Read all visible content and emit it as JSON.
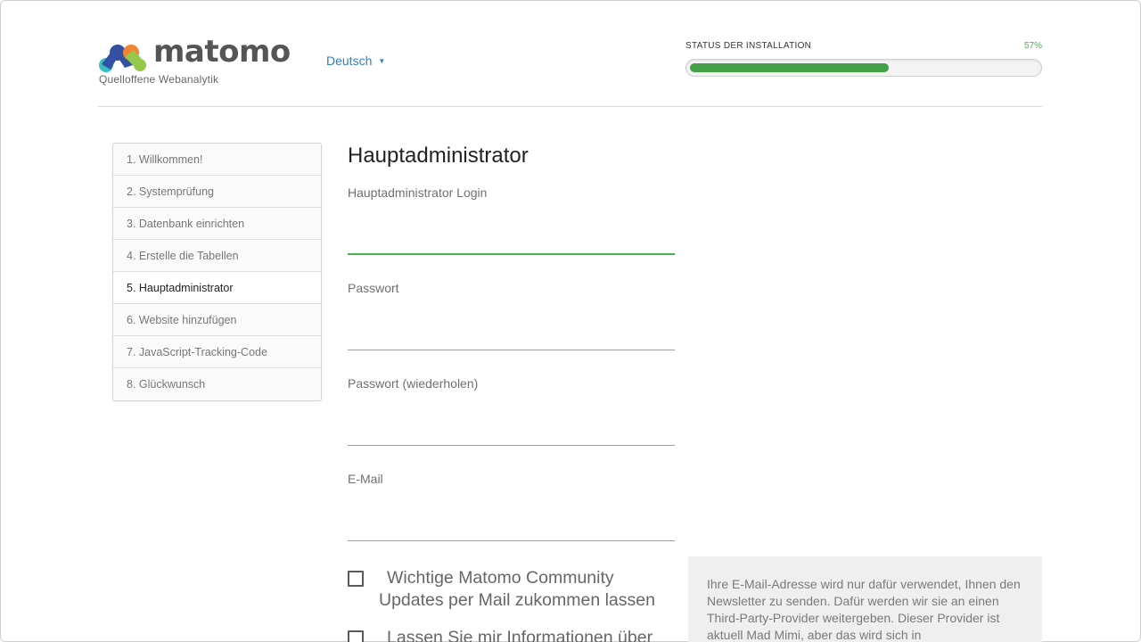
{
  "header": {
    "logo_text": "matomo",
    "tagline": "Quelloffene Webanalytik",
    "language": "Deutsch",
    "progress_label": "STATUS DER INSTALLATION",
    "progress_text": "57%",
    "progress_fraction": 0.57
  },
  "steps": [
    {
      "label": "1. Willkommen!"
    },
    {
      "label": "2. Systemprüfung"
    },
    {
      "label": "3. Datenbank einrichten"
    },
    {
      "label": "4. Erstelle die Tabellen"
    },
    {
      "label": "5. Hauptadministrator",
      "active": true
    },
    {
      "label": "6. Website hinzufügen"
    },
    {
      "label": "7. JavaScript-Tracking-Code"
    },
    {
      "label": "8. Glückwunsch"
    }
  ],
  "form": {
    "title": "Hauptadministrator",
    "login_label": "Hauptadministrator Login",
    "login_value": "",
    "password_label": "Passwort",
    "password_value": "",
    "password_repeat_label": "Passwort (wiederholen)",
    "password_repeat_value": "",
    "email_label": "E-Mail",
    "email_value": "",
    "community_updates_label": "Wichtige Matomo Community Updates per Mail zukommen lassen",
    "community_updates_checked": false,
    "info_label": "Lassen Sie mir Informationen über",
    "info_checked": false
  },
  "info_box": {
    "text": "Ihre E-Mail-Adresse wird nur dafür verwendet, Ihnen den Newsletter zu senden. Dafür werden wir sie an einen Third-Party-Provider weitergeben. Dieser Provider ist aktuell Mad Mimi, aber das wird sich in"
  },
  "colors": {
    "accent_green": "#43a047",
    "link_blue": "#2f7ec2",
    "logo_blue": "#3450a3",
    "logo_orange": "#f38334",
    "logo_teal": "#35bfc0",
    "logo_green": "#95c748"
  }
}
